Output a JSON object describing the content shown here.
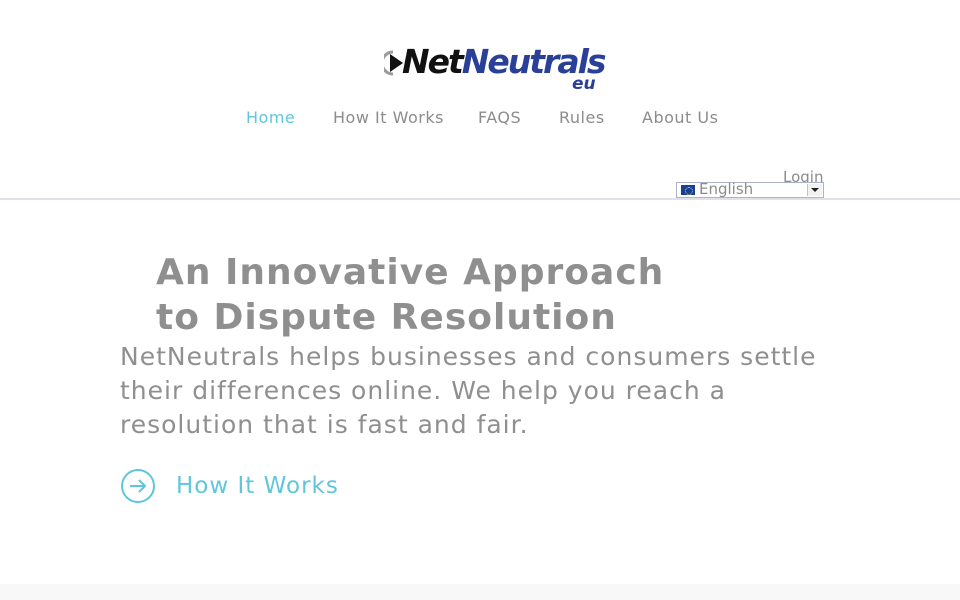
{
  "brand": {
    "name_part1": "Net",
    "name_part2": "Neutrals",
    "suffix": "eu",
    "logo_icon": "play-circle-icon",
    "colors": {
      "dark": "#111111",
      "blue": "#2a3f98"
    }
  },
  "nav": {
    "items": [
      {
        "label": "Home",
        "active": true
      },
      {
        "label": "How It Works",
        "active": false
      },
      {
        "label": "FAQS",
        "active": false
      },
      {
        "label": "Rules",
        "active": false
      },
      {
        "label": "About Us",
        "active": false
      }
    ],
    "active_color": "#5fc6dc"
  },
  "account": {
    "login_label": "Login"
  },
  "language": {
    "selected": "English",
    "flag_icon": "eu-flag-icon"
  },
  "hero": {
    "title_line1": "An Innovative Approach",
    "title_line2": "to Dispute Resolution",
    "body": "NetNeutrals helps businesses and consumers settle\ntheir differences online.  We help you reach a\nresolution that is fast and fair.",
    "cta_label": "How It Works",
    "cta_icon": "arrow-right-circle-icon",
    "accent_color": "#5fc6dc"
  }
}
